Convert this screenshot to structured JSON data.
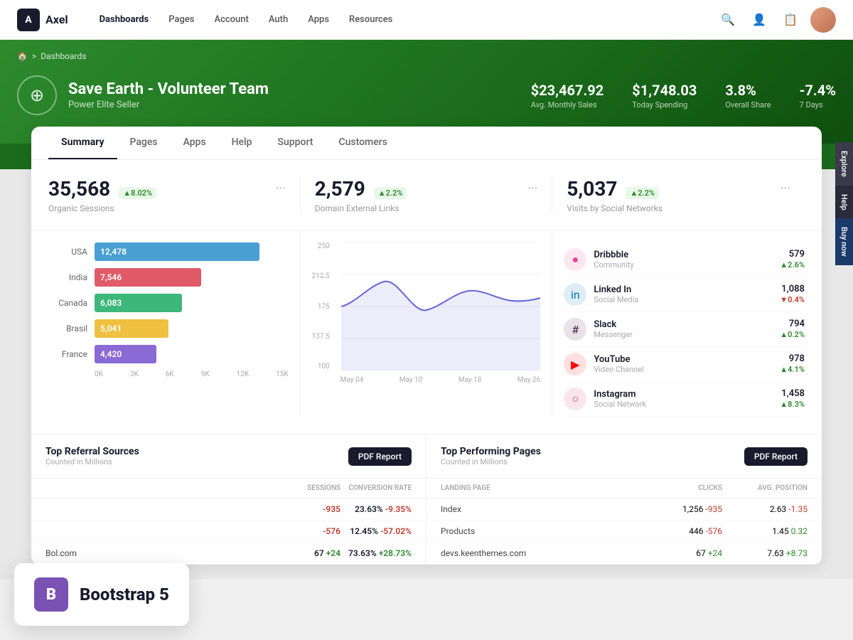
{
  "nav": {
    "logo_letter": "A",
    "logo_name": "Axel",
    "links": [
      "Dashboards",
      "Pages",
      "Account",
      "Auth",
      "Apps",
      "Resources"
    ],
    "active_link": "Dashboards"
  },
  "breadcrumb": {
    "home": "🏠",
    "separator": ">",
    "current": "Dashboards"
  },
  "hero": {
    "org_name": "Save Earth - Volunteer Team",
    "org_subtitle": "Power Elite Seller",
    "stats": [
      {
        "value": "$23,467.92",
        "label": "Avg. Monthly Sales"
      },
      {
        "value": "$1,748.03",
        "label": "Today Spending"
      },
      {
        "value": "3.8%",
        "label": "Overall Share"
      },
      {
        "value": "-7.4%",
        "label": "7 Days"
      }
    ]
  },
  "tabs": [
    "Summary",
    "Pages",
    "Apps",
    "Help",
    "Support",
    "Customers"
  ],
  "active_tab": "Summary",
  "metrics": [
    {
      "value": "35,568",
      "badge": "▲8.02%",
      "badge_type": "green",
      "label": "Organic Sessions"
    },
    {
      "value": "2,579",
      "badge": "▲2.2%",
      "badge_type": "green",
      "label": "Domain External Links"
    },
    {
      "value": "5,037",
      "badge": "▲2.2%",
      "badge_type": "green",
      "label": "Visits by Social Networks"
    }
  ],
  "countries": [
    {
      "name": "USA",
      "value": "12,478",
      "color": "#4a9fd4",
      "width": "85%"
    },
    {
      "name": "India",
      "value": "7,546",
      "color": "#e05a6a",
      "width": "55%"
    },
    {
      "name": "Canada",
      "value": "6,083",
      "color": "#3db87a",
      "width": "45%"
    },
    {
      "name": "Brasil",
      "value": "5,041",
      "color": "#f0c040",
      "width": "38%"
    },
    {
      "name": "France",
      "value": "4,420",
      "color": "#8a6ad4",
      "width": "32%"
    }
  ],
  "bar_xaxis": [
    "0K",
    "3K",
    "6K",
    "9K",
    "12K",
    "15K"
  ],
  "line_chart": {
    "y_labels": [
      "250",
      "212.5",
      "175",
      "137.5",
      "100"
    ],
    "x_labels": [
      "May 04",
      "May 10",
      "May 18",
      "May 26"
    ]
  },
  "social_networks": [
    {
      "name": "Dribbble",
      "type": "Community",
      "count": "579",
      "badge": "▲2.6%",
      "badge_type": "green",
      "color": "#e84393",
      "icon": "●"
    },
    {
      "name": "Linked In",
      "type": "Social Media",
      "count": "1,088",
      "badge": "▼0.4%",
      "badge_type": "red",
      "color": "#0077b5",
      "icon": "in"
    },
    {
      "name": "Slack",
      "type": "Messenger",
      "count": "794",
      "badge": "▲0.2%",
      "badge_type": "green",
      "color": "#4a154b",
      "icon": "#"
    },
    {
      "name": "YouTube",
      "type": "Video Channel",
      "count": "978",
      "badge": "▲4.1%",
      "badge_type": "green",
      "color": "#ff0000",
      "icon": "▶"
    },
    {
      "name": "Instagram",
      "type": "Social Network",
      "count": "1,458",
      "badge": "▲8.3%",
      "badge_type": "green",
      "color": "#e1306c",
      "icon": "○"
    }
  ],
  "referral_section": {
    "title": "Top Referral Sources",
    "subtitle": "Counted in Millions",
    "pdf_btn": "PDF Report",
    "headers": [
      "",
      "SESSIONS",
      "CONVERSION RATE"
    ],
    "rows": [
      {
        "name": "",
        "sessions": "-935",
        "conversion": "23.63%",
        "conv_delta": "-9.35%",
        "sess_type": "red"
      },
      {
        "name": "",
        "sessions": "-576",
        "conversion": "12.45%",
        "conv_delta": "-57.02%",
        "sess_type": "red"
      },
      {
        "name": "Bol.com",
        "sessions": "67",
        "conversion": "73.63%",
        "conv_delta": "+28.73%",
        "sess_delta": "+24",
        "sess_type": "green"
      }
    ]
  },
  "pages_section": {
    "title": "Top Performing Pages",
    "subtitle": "Counted in Millions",
    "pdf_btn": "PDF Report",
    "headers": [
      "LANDING PAGE",
      "CLICKS",
      "AVG. POSITION"
    ],
    "rows": [
      {
        "page": "Index",
        "clicks": "1,256",
        "clicks_delta": "-935",
        "position": "2.63",
        "pos_delta": "-1.35",
        "clicks_type": "red",
        "pos_type": "red"
      },
      {
        "page": "Products",
        "clicks": "446",
        "clicks_delta": "-576",
        "position": "1.45",
        "pos_delta": "0.32",
        "clicks_type": "red",
        "pos_type": "green"
      },
      {
        "page": "devs.keenthemes.com",
        "clicks": "67",
        "clicks_delta": "+24",
        "position": "7.63",
        "pos_delta": "+8.73",
        "clicks_type": "green",
        "pos_type": "green"
      }
    ]
  },
  "sidebar_panels": [
    "Explore",
    "Help",
    "Buy now"
  ],
  "bootstrap": {
    "icon": "B",
    "text": "Bootstrap 5"
  }
}
